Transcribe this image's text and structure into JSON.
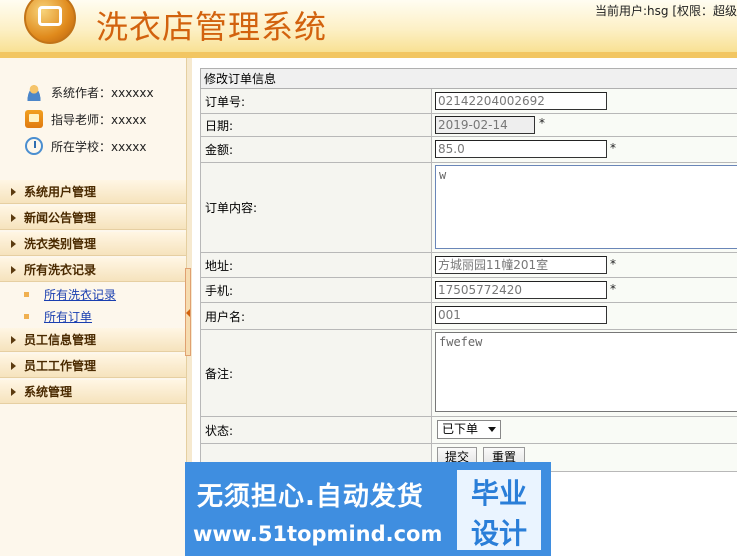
{
  "header": {
    "title": "洗衣店管理系统",
    "user_info": "当前用户:hsg [权限：超级"
  },
  "sidebar": {
    "info": [
      {
        "label": "系统作者：xxxxxx",
        "icon": "user-icon"
      },
      {
        "label": "指导老师：xxxxx",
        "icon": "teacher-icon"
      },
      {
        "label": "所在学校：xxxxx",
        "icon": "school-icon"
      }
    ],
    "menu": [
      {
        "label": "系统用户管理"
      },
      {
        "label": "新闻公告管理"
      },
      {
        "label": "洗衣类别管理"
      },
      {
        "label": "所有洗衣记录"
      },
      {
        "label": "员工信息管理"
      },
      {
        "label": "员工工作管理"
      },
      {
        "label": "系统管理"
      }
    ],
    "submenu": [
      {
        "label": "所有洗衣记录"
      },
      {
        "label": "所有订单"
      }
    ]
  },
  "form": {
    "title": "修改订单信息",
    "order_no": {
      "label": "订单号:",
      "value": "02142204002692"
    },
    "date": {
      "label": "日期:",
      "value": "2019-02-14",
      "required": "*"
    },
    "amount": {
      "label": "金额:",
      "value": "85.0",
      "required": "*"
    },
    "content": {
      "label": "订单内容:",
      "value": "w"
    },
    "address": {
      "label": "地址:",
      "value": "方城丽园11幢201室",
      "required": "*"
    },
    "phone": {
      "label": "手机:",
      "value": "17505772420",
      "required": "*"
    },
    "username": {
      "label": "用户名:",
      "value": "001"
    },
    "remark": {
      "label": "备注:",
      "value": "fwefew"
    },
    "status": {
      "label": "状态:",
      "value": "已下单"
    },
    "submit_label": "提交",
    "reset_label": "重置"
  },
  "watermark": {
    "line1": "无须担心.自动发货",
    "line2": "www.51topmind.com",
    "badge1": "毕业",
    "badge2": "设计"
  },
  "colors": {
    "title": "#d2620e",
    "watermark_bg": "#3f8ee0",
    "link": "#1a3fb0"
  }
}
